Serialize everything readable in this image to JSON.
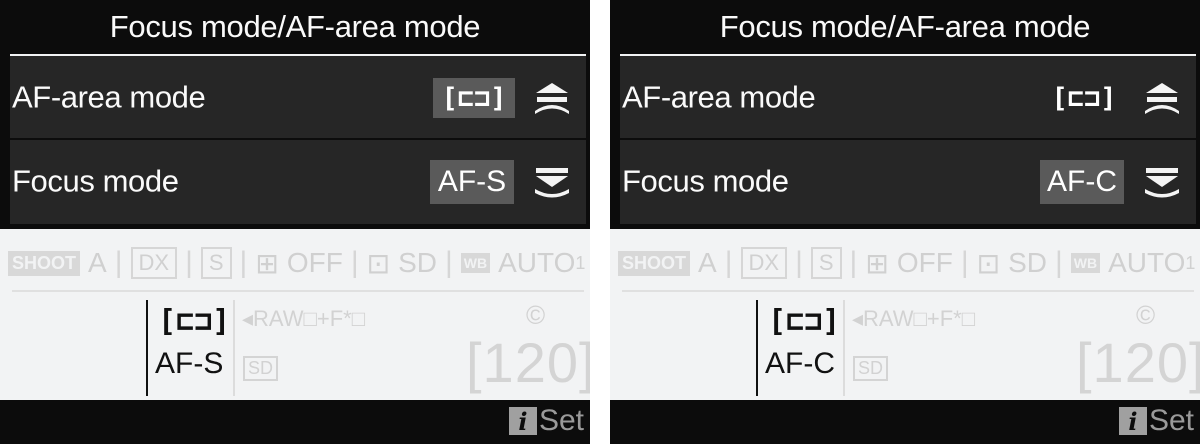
{
  "screens": [
    {
      "title": "Focus mode/AF-area mode",
      "af_area_label": "AF-area mode",
      "af_area_value": "[⊏⊐]",
      "focus_mode_label": "Focus mode",
      "focus_mode_value": "AF-S",
      "status": {
        "shoot": "SHOOT",
        "mode": "A",
        "dx": "DX",
        "s": "S",
        "ae": "OFF",
        "picture": "SD",
        "wb_chip": "WB",
        "wb": "AUTO",
        "wb_suffix": "1",
        "sep": "|"
      },
      "info": {
        "af_area_icon": "[⊏⊐]",
        "af_mode": "AF-S",
        "quality": "◂RAW□+F*□",
        "card": "SD",
        "copyright": "©",
        "shots": "[120]"
      },
      "set_label": "Set"
    },
    {
      "title": "Focus mode/AF-area mode",
      "af_area_label": "AF-area mode",
      "af_area_value": "[⊏⊐]",
      "focus_mode_label": "Focus mode",
      "focus_mode_value": "AF-C",
      "status": {
        "shoot": "SHOOT",
        "mode": "A",
        "dx": "DX",
        "s": "S",
        "ae": "OFF",
        "picture": "SD",
        "wb_chip": "WB",
        "wb": "AUTO",
        "wb_suffix": "1",
        "sep": "|"
      },
      "info": {
        "af_area_icon": "[⊏⊐]",
        "af_mode": "AF-C",
        "quality": "◂RAW□+F*□",
        "card": "SD",
        "copyright": "©",
        "shots": "[120]"
      },
      "set_label": "Set"
    }
  ],
  "icons": {
    "command_dial_up": "sub-command-dial-icon",
    "command_dial_down": "main-command-dial-icon",
    "info": "i-button-icon"
  },
  "colors": {
    "title_bg": "#0c0c0c",
    "row_bg": "#262626",
    "chip_bg": "#5a5a5a",
    "panel_bg": "#f2f3f4"
  }
}
